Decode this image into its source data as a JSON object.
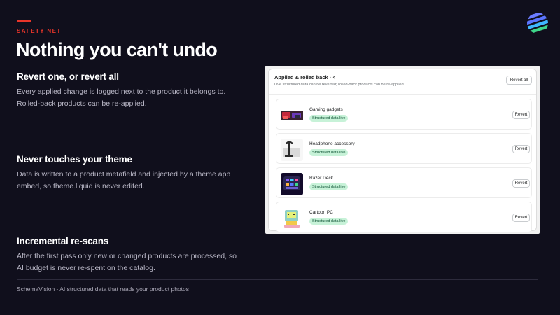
{
  "eyebrow": "SAFETY NET",
  "title": "Nothing you can't undo",
  "features": [
    {
      "heading": "Revert one, or revert all",
      "line1": "Every applied change is logged next to the product it belongs to.",
      "line2": "Rolled-back products can be re-applied."
    },
    {
      "heading": "Never touches your theme",
      "line1": "Data is written to a product metafield and injected by a theme app",
      "line2": "embed, so theme.liquid is never edited."
    },
    {
      "heading": "Incremental re-scans",
      "line1": "After the first pass only new or changed products are processed, so",
      "line2": "AI budget is never re-spent on the catalog."
    }
  ],
  "footer": "SchemaVision - AI structured data that reads your product photos",
  "panel": {
    "title": "Applied & rolled back · 4",
    "subtitle": "Live structured data can be reverted; rolled-back products can be re-applied.",
    "revert_all_label": "Revert all",
    "items": [
      {
        "name": "Gaming gadgets",
        "status": "Structured data live",
        "action": "Revert",
        "thumb_icon": "gaming-gadgets-thumbnail"
      },
      {
        "name": "Headphone accessory",
        "status": "Structured data live",
        "action": "Revert",
        "thumb_icon": "headphone-stand-thumbnail"
      },
      {
        "name": "Razer Deck",
        "status": "Structured data live",
        "action": "Revert",
        "thumb_icon": "stream-deck-thumbnail"
      },
      {
        "name": "Cartoon PC",
        "status": "Structured data live",
        "action": "Revert",
        "thumb_icon": "retro-computer-thumbnail"
      }
    ]
  },
  "colors": {
    "background": "#100f1c",
    "accent": "#e8352a",
    "badge_bg": "#c7f2d8",
    "badge_text": "#0c5132"
  }
}
